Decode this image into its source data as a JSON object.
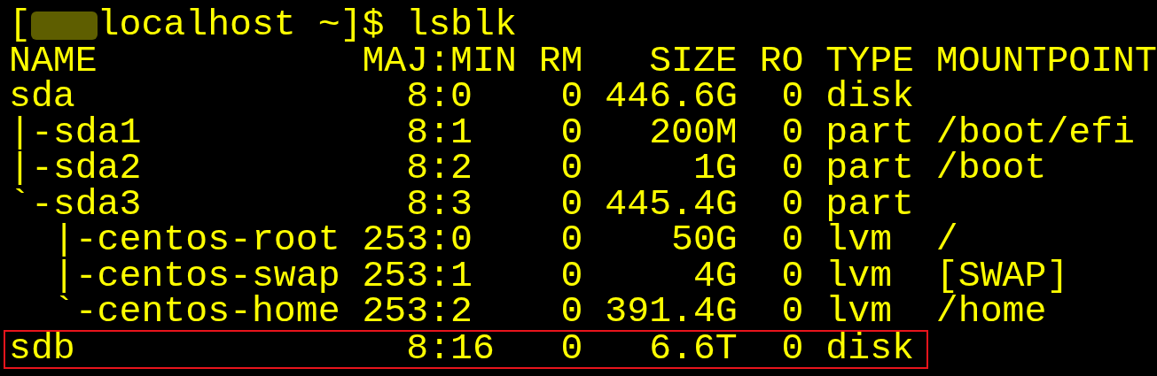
{
  "prompt": {
    "open": "[",
    "redacted": true,
    "rest": "localhost ~]$ lsblk"
  },
  "header": {
    "name": "NAME",
    "majmin": "MAJ:MIN",
    "rm": "RM",
    "size": "SIZE",
    "ro": "RO",
    "type": "TYPE",
    "mountpoint": "MOUNTPOINT"
  },
  "rows": [
    {
      "name": "sda",
      "majmin": "8:0",
      "rm": "0",
      "size": "446.6G",
      "ro": "0",
      "type": "disk",
      "highlighted": false
    },
    {
      "name": "|-sda1",
      "majmin": "8:1",
      "rm": "0",
      "size": "200M",
      "ro": "0",
      "type": "part",
      "mountpoint": "/boot/efi",
      "highlighted": false
    },
    {
      "name": "|-sda2",
      "majmin": "8:2",
      "rm": "0",
      "size": "1G",
      "ro": "0",
      "type": "part",
      "mountpoint": "/boot",
      "highlighted": false
    },
    {
      "name": "`-sda3",
      "majmin": "8:3",
      "rm": "0",
      "size": "445.4G",
      "ro": "0",
      "type": "part",
      "highlighted": false
    },
    {
      "name": "  |-centos-root",
      "majmin": "253:0",
      "rm": "0",
      "size": "50G",
      "ro": "0",
      "type": "lvm",
      "mountpoint": "/",
      "highlighted": false
    },
    {
      "name": "  |-centos-swap",
      "majmin": "253:1",
      "rm": "0",
      "size": "4G",
      "ro": "0",
      "type": "lvm",
      "mountpoint": "[SWAP]",
      "highlighted": false
    },
    {
      "name": "  `-centos-home",
      "majmin": "253:2",
      "rm": "0",
      "size": "391.4G",
      "ro": "0",
      "type": "lvm",
      "mountpoint": "/home",
      "highlighted": false
    },
    {
      "name": "sdb",
      "majmin": "8:16",
      "rm": "0",
      "size": "6.6T",
      "ro": "0",
      "type": "disk",
      "highlighted": true
    }
  ]
}
